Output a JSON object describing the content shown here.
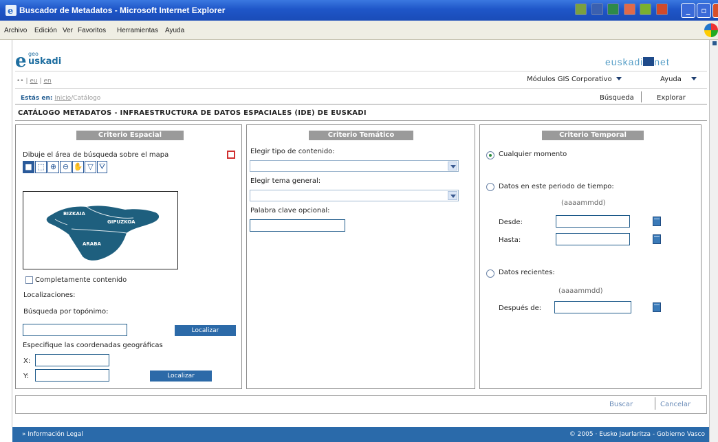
{
  "window": {
    "title": "Buscador de Metadatos - Microsoft Internet Explorer"
  },
  "menu": [
    "Archivo",
    "Edición",
    "Ver",
    "Favoritos",
    "Herramientas",
    "Ayuda"
  ],
  "logos": {
    "geo_small": "geo",
    "geo_name": "uskadi",
    "geo_e": "e",
    "net_part1": "euskadi",
    "net_part2": "net"
  },
  "language": {
    "prefix": "•• |",
    "eu": "eu",
    "divider": "|",
    "en": "en"
  },
  "top_menu": {
    "modulos": "Módulos GIS Corporativo",
    "ayuda": "Ayuda"
  },
  "breadcrumb": {
    "label": "Estás en:",
    "home": "Inicio",
    "sep": "/",
    "current": "Catálogo"
  },
  "tabs": {
    "busqueda": "Búsqueda",
    "explorar": "Explorar"
  },
  "catalog_title": "CATÁLOGO METADATOS - INFRAESTRUCTURA DE DATOS ESPACIALES (IDE) DE EUSKADI",
  "spatial": {
    "header": "Criterio Espacial",
    "draw_label": "Dibuje el área de búsqueda sobre el mapa",
    "map_regions": [
      "BIZKAIA",
      "GIPUZKOA",
      "ARABA"
    ],
    "contained_label": "Completamente contenido",
    "locations_label": "Localizaciones:",
    "toponym_label": "Búsqueda por topónimo:",
    "toponym_value": "",
    "locate_button": "Localizar",
    "coords_label": "Especifique las coordenadas geográficas",
    "x_label": "X:",
    "y_label": "Y:",
    "x_value": "",
    "y_value": "",
    "locate_button_2": "Localizar"
  },
  "thematic": {
    "header": "Criterio Temático",
    "content_type_label": "Elegir tipo de contenido:",
    "content_type_value": "",
    "theme_label": "Elegir tema general:",
    "theme_value": "",
    "keyword_label": "Palabra clave opcional:",
    "keyword_value": ""
  },
  "temporal": {
    "header": "Criterio Temporal",
    "any_time": "Cualquier momento",
    "period_label": "Datos en este periodo de tiempo:",
    "format_hint": "(aaaammdd)",
    "desde_label": "Desde:",
    "hasta_label": "Hasta:",
    "desde_value": "",
    "hasta_value": "",
    "recent_label": "Datos recientes:",
    "format_hint_2": "(aaaammdd)",
    "despues_label": "Después de:",
    "despues_value": ""
  },
  "actions": {
    "buscar": "Buscar",
    "cancelar": "Cancelar"
  },
  "footer": {
    "left": "» Información Legal",
    "right": "© 2005 · Eusko Jaurlaritza - Gobierno Vasco"
  },
  "colors": {
    "titlebar": "#1f56c8",
    "accent_blue": "#2c6aa8",
    "panel_header": "#9a9a9a",
    "footer": "#2a6aaa",
    "map_land": "#1e5f7e"
  }
}
